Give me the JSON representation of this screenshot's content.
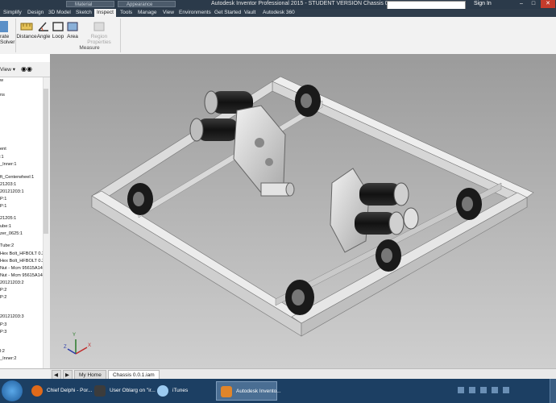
{
  "titlebar": {
    "title": "Autodesk Inventor Professional 2015 - STUDENT VERSION   Chassis 0.0.1",
    "material_placeholder": "Material",
    "appearance_placeholder": "Appearance",
    "sign_in": "Sign In"
  },
  "tabs": [
    "Simplify",
    "Design",
    "3D Model",
    "Sketch",
    "Inspect",
    "Tools",
    "Manage",
    "View",
    "Environments",
    "Get Started",
    "Vault",
    "Autodesk 360"
  ],
  "active_tab": "Inspect",
  "ribbon": {
    "solver_label_1": "rate",
    "solver_label_2": "Solver",
    "buttons": [
      "Distance",
      "Angle",
      "Loop",
      "Area",
      "Region Properties"
    ],
    "panel_label": "Measure"
  },
  "browser": {
    "view_label": "View",
    "items": [
      "w",
      "ns",
      "ent",
      ":1",
      "_Inner:1",
      "ft_Centerwheel:1",
      "21203:1",
      "20121203:1",
      "P:1",
      "P:1",
      "21205:1",
      "ube:1",
      "zer_0625:1",
      "Tube:2",
      "Hex Bolt_HFBOLT 0.3",
      "Hex Bolt_HFBOLT 0.3",
      "Nut - Mcm 95615A140",
      "Nut - Mcm 95615A140",
      "20121203:2",
      "P:2",
      "P:2",
      "20121203:3",
      "P:3",
      "P:3",
      "l:2",
      "_Inner:2"
    ]
  },
  "doctabs": {
    "home": "My Home",
    "doc": "Chassis 0.0.1.iam"
  },
  "taskbar": {
    "items": [
      "Chief Delphi - Por...",
      "User Oblarg on \"ir...",
      "iTunes",
      "Autodesk Invento..."
    ]
  },
  "triad": {
    "x": "X",
    "y": "Y",
    "z": "Z"
  }
}
